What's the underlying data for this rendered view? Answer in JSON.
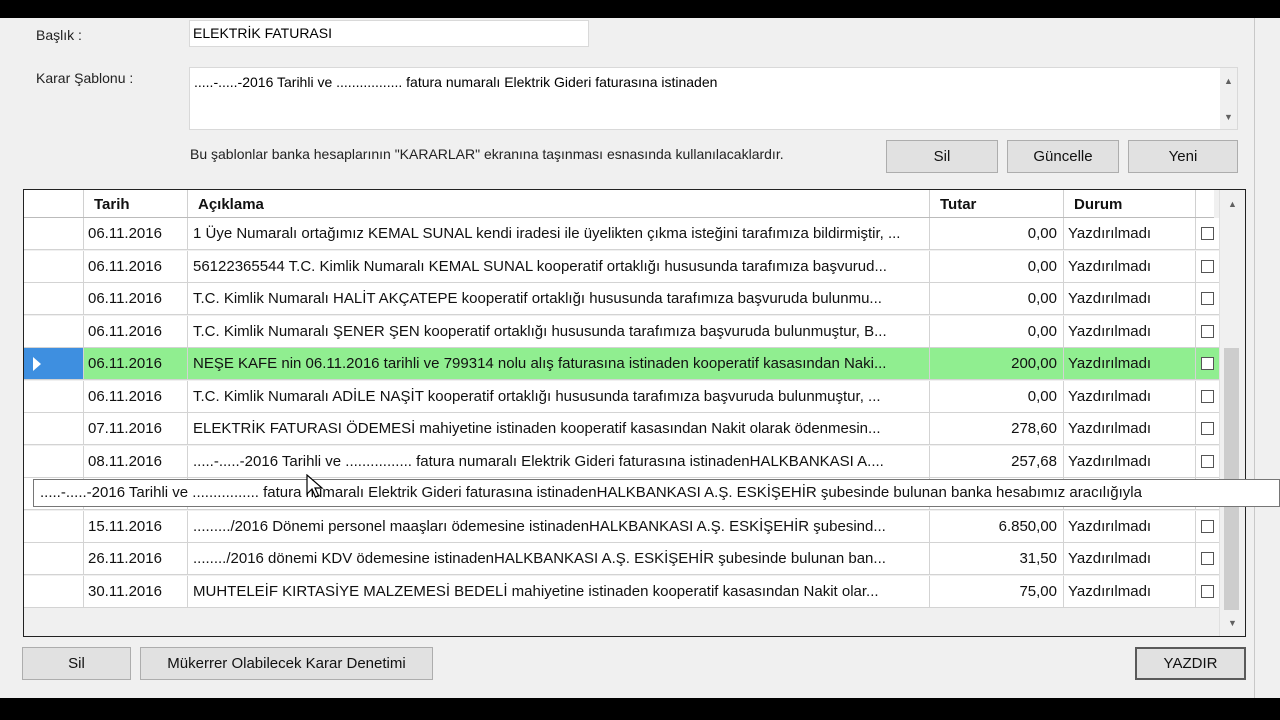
{
  "form": {
    "baslik_label": "Başlık :",
    "baslik_value": "ELEKTRİK FATURASI",
    "sablon_label": "Karar Şablonu :",
    "sablon_value": ".....-.....-2016 Tarihli ve ................. fatura numaralı Elektrik Gideri faturasına istinaden",
    "hint": "Bu şablonlar banka hesaplarının \"KARARLAR\" ekranına taşınması esnasında kullanılacaklardır.",
    "buttons": {
      "sil": "Sil",
      "guncelle": "Güncelle",
      "yeni": "Yeni"
    }
  },
  "grid": {
    "columns": {
      "tarih": "Tarih",
      "aciklama": "Açıklama",
      "tutar": "Tutar",
      "durum": "Durum"
    },
    "rows": [
      {
        "tarih": "06.11.2016",
        "aciklama": "1 Üye Numaralı ortağımız KEMAL  SUNAL kendi iradesi ile üyelikten çıkma isteğini tarafımıza bildirmiştir, ...",
        "tutar": "0,00",
        "durum": "Yazdırılmadı"
      },
      {
        "tarih": "06.11.2016",
        "aciklama": "56122365544 T.C. Kimlik Numaralı KEMAL  SUNAL kooperatif ortaklığı hususunda tarafımıza başvurud...",
        "tutar": "0,00",
        "durum": "Yazdırılmadı"
      },
      {
        "tarih": "06.11.2016",
        "aciklama": " T.C. Kimlik Numaralı HALİT  AKÇATEPE kooperatif ortaklığı hususunda tarafımıza başvuruda bulunmu...",
        "tutar": "0,00",
        "durum": "Yazdırılmadı"
      },
      {
        "tarih": "06.11.2016",
        "aciklama": " T.C. Kimlik Numaralı ŞENER  ŞEN kooperatif ortaklığı hususunda tarafımıza başvuruda bulunmuştur, B...",
        "tutar": "0,00",
        "durum": "Yazdırılmadı"
      },
      {
        "tarih": "06.11.2016",
        "aciklama": "NEŞE KAFE nin 06.11.2016 tarihli ve 799314 nolu alış faturasına istinaden kooperatif kasasından Naki...",
        "tutar": "200,00",
        "durum": "Yazdırılmadı",
        "selected": true
      },
      {
        "tarih": "06.11.2016",
        "aciklama": " T.C. Kimlik Numaralı ADİLE  NAŞİT kooperatif ortaklığı hususunda tarafımıza başvuruda bulunmuştur, ...",
        "tutar": "0,00",
        "durum": "Yazdırılmadı"
      },
      {
        "tarih": "07.11.2016",
        "aciklama": "ELEKTRİK FATURASI ÖDEMESİ mahiyetine istinaden kooperatif kasasından Nakit olarak ödenmesin...",
        "tutar": "278,60",
        "durum": "Yazdırılmadı"
      },
      {
        "tarih": "08.11.2016",
        "aciklama": ".....-.....-2016 Tarihli ve ................ fatura numaralı Elektrik Gideri faturasına istinadenHALKBANKASI A....",
        "tutar": "257,68",
        "durum": "Yazdırılmadı"
      },
      {
        "tarih": "",
        "aciklama": "",
        "tutar": "",
        "durum": ""
      },
      {
        "tarih": "15.11.2016",
        "aciklama": "........./2016 Dönemi personel maaşları ödemesine istinadenHALKBANKASI A.Ş. ESKİŞEHİR şubesind...",
        "tutar": "6.850,00",
        "durum": "Yazdırılmadı"
      },
      {
        "tarih": "26.11.2016",
        "aciklama": "......../2016 dönemi KDV ödemesine istinadenHALKBANKASI A.Ş. ESKİŞEHİR şubesinde bulunan ban...",
        "tutar": "31,50",
        "durum": "Yazdırılmadı"
      },
      {
        "tarih": "30.11.2016",
        "aciklama": "MUHTELEİF KIRTASİYE MALZEMESİ BEDELİ mahiyetine istinaden kooperatif kasasından Nakit olar...",
        "tutar": "75,00",
        "durum": "Yazdırılmadı"
      }
    ]
  },
  "tooltip": ".....-.....-2016 Tarihli ve ................ fatura numaralı Elektrik Gideri faturasına istinadenHALKBANKASI A.Ş. ESKİŞEHİR şubesinde bulunan banka hesabımız aracılığıyla",
  "bottom": {
    "sil": "Sil",
    "mukerrer": "Mükerrer Olabilecek Karar Denetimi",
    "yazdir": "YAZDIR"
  },
  "colors": {
    "selected_row": "#90ee90",
    "row_indicator": "#3e8fe0"
  },
  "icons": {
    "scroll_up": "scroll-up-arrow-icon",
    "scroll_down": "scroll-down-arrow-icon",
    "current_row": "current-row-arrow-icon",
    "cursor": "mouse-pointer-icon"
  }
}
